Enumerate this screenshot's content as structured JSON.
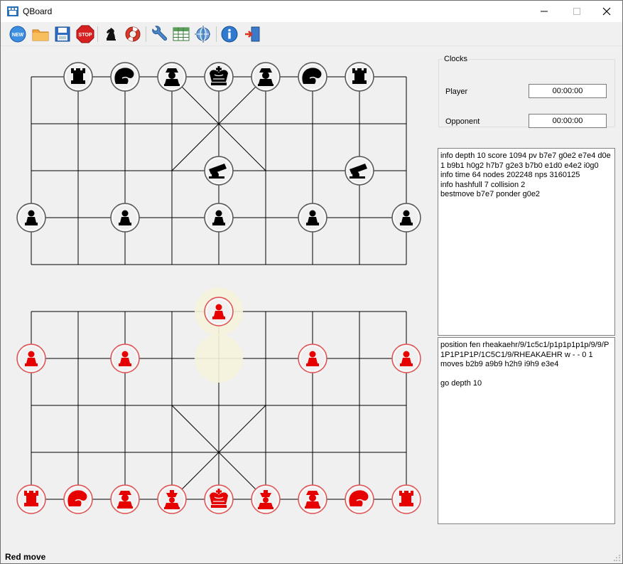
{
  "window": {
    "title": "QBoard",
    "minimize_icon": "minimize-icon",
    "maximize_icon": "maximize-icon",
    "close_icon": "close-icon"
  },
  "toolbar": {
    "buttons": [
      {
        "name": "new-game-button",
        "icon": "new-icon",
        "label": "NEW"
      },
      {
        "name": "open-button",
        "icon": "folder-icon"
      },
      {
        "name": "save-button",
        "icon": "floppy-icon"
      },
      {
        "name": "stop-button",
        "icon": "stop-icon",
        "label": "STOP"
      },
      {
        "name": "engine-button",
        "icon": "chess-knight-icon"
      },
      {
        "name": "help-ring-button",
        "icon": "lifebuoy-icon"
      },
      {
        "name": "settings-button",
        "icon": "wrench-icon"
      },
      {
        "name": "table-button",
        "icon": "table-icon"
      },
      {
        "name": "network-button",
        "icon": "network-icon"
      },
      {
        "name": "about-button",
        "icon": "info-icon"
      },
      {
        "name": "exit-button",
        "icon": "exit-door-icon"
      }
    ]
  },
  "board": {
    "files": 9,
    "ranks": 10,
    "colors": {
      "line": "#000000",
      "black_piece": "#000000",
      "red_piece": "#e60000",
      "highlight": "#f5f2dc",
      "piece_face": "#f0f0f0"
    },
    "pieces": [
      {
        "side": "black",
        "type": "rook",
        "file": 1,
        "rank": 0
      },
      {
        "side": "black",
        "type": "horse",
        "file": 2,
        "rank": 0
      },
      {
        "side": "black",
        "type": "elephant",
        "file": 3,
        "rank": 0
      },
      {
        "side": "black",
        "type": "king",
        "file": 4,
        "rank": 0
      },
      {
        "side": "black",
        "type": "elephant",
        "file": 5,
        "rank": 0
      },
      {
        "side": "black",
        "type": "horse",
        "file": 6,
        "rank": 0
      },
      {
        "side": "black",
        "type": "rook",
        "file": 7,
        "rank": 0
      },
      {
        "side": "black",
        "type": "cannon",
        "file": 4,
        "rank": 2
      },
      {
        "side": "black",
        "type": "cannon",
        "file": 7,
        "rank": 2
      },
      {
        "side": "black",
        "type": "pawn",
        "file": 0,
        "rank": 3
      },
      {
        "side": "black",
        "type": "pawn",
        "file": 2,
        "rank": 3
      },
      {
        "side": "black",
        "type": "pawn",
        "file": 4,
        "rank": 3
      },
      {
        "side": "black",
        "type": "pawn",
        "file": 6,
        "rank": 3
      },
      {
        "side": "black",
        "type": "pawn",
        "file": 8,
        "rank": 3
      },
      {
        "side": "red",
        "type": "pawn",
        "file": 4,
        "rank": 5
      },
      {
        "side": "red",
        "type": "pawn",
        "file": 0,
        "rank": 6
      },
      {
        "side": "red",
        "type": "pawn",
        "file": 2,
        "rank": 6
      },
      {
        "side": "red",
        "type": "pawn",
        "file": 6,
        "rank": 6
      },
      {
        "side": "red",
        "type": "pawn",
        "file": 8,
        "rank": 6
      },
      {
        "side": "red",
        "type": "rook",
        "file": 0,
        "rank": 9
      },
      {
        "side": "red",
        "type": "horse",
        "file": 1,
        "rank": 9
      },
      {
        "side": "red",
        "type": "elephant",
        "file": 2,
        "rank": 9
      },
      {
        "side": "red",
        "type": "advisor",
        "file": 3,
        "rank": 9
      },
      {
        "side": "red",
        "type": "king",
        "file": 4,
        "rank": 9
      },
      {
        "side": "red",
        "type": "advisor",
        "file": 5,
        "rank": 9
      },
      {
        "side": "red",
        "type": "elephant",
        "file": 6,
        "rank": 9
      },
      {
        "side": "red",
        "type": "horse",
        "file": 7,
        "rank": 9
      },
      {
        "side": "red",
        "type": "rook",
        "file": 8,
        "rank": 9
      }
    ],
    "highlights": [
      {
        "file": 4,
        "rank": 5
      },
      {
        "file": 4,
        "rank": 6
      }
    ]
  },
  "clocks": {
    "title": "Clocks",
    "player_label": "Player",
    "player_time": "00:00:00",
    "opponent_label": "Opponent",
    "opponent_time": "00:00:00"
  },
  "engine_output": "info depth 10 score 1094 pv b7e7 g0e2 e7e4 d0e1 b9b1 h0g2 h7b7 g2e3 b7b0 e1d0 e4e2 i0g0\ninfo time 64 nodes 202248 nps 3160125\ninfo hashfull 7 collision 2\nbestmove b7e7 ponder g0e2",
  "engine_input": "position fen rheakaehr/9/1c5c1/p1p1p1p1p/9/9/P1P1P1P1P/1C5C1/9/RHEAKAEHR w - - 0 1\nmoves b2b9 a9b9 h2h9 i9h9 e3e4\n\ngo depth 10",
  "status": "Red move"
}
